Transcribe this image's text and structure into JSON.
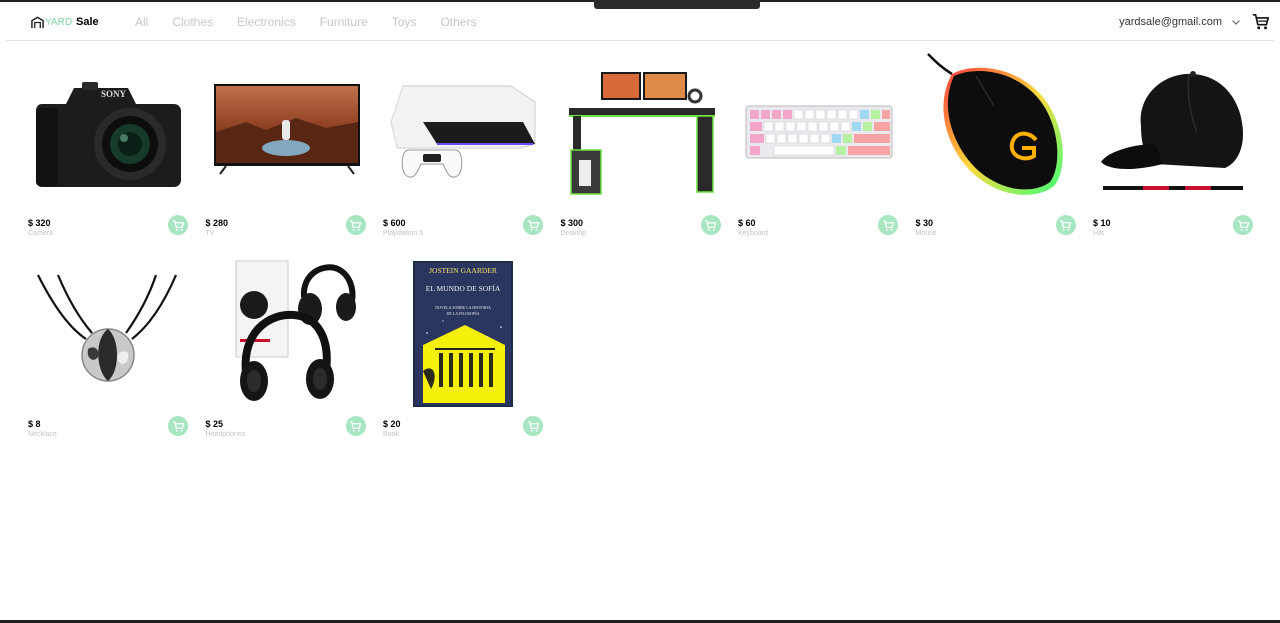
{
  "header": {
    "logo_yard": "YARD",
    "logo_sale": "Sale",
    "nav": [
      "All",
      "Clothes",
      "Electronics",
      "Furniture",
      "Toys",
      "Others"
    ],
    "email": "yardsale@gmail.com",
    "icons": {
      "logo": "yard-logo-icon",
      "dropdown": "chevron-down-icon",
      "cart": "shopping-cart-icon"
    }
  },
  "products": [
    {
      "price": "$ 320",
      "name": "Camera",
      "image": "camera-image"
    },
    {
      "price": "$ 280",
      "name": "TV",
      "image": "tv-image"
    },
    {
      "price": "$ 600",
      "name": "Playstation 5",
      "image": "playstation-image"
    },
    {
      "price": "$ 300",
      "name": "Desktop",
      "image": "desk-image"
    },
    {
      "price": "$ 60",
      "name": "Keyboard",
      "image": "keyboard-image"
    },
    {
      "price": "$ 30",
      "name": "Mouse",
      "image": "mouse-image"
    },
    {
      "price": "$ 10",
      "name": "Hat",
      "image": "cap-image"
    },
    {
      "price": "$ 8",
      "name": "Necklace",
      "image": "necklace-image"
    },
    {
      "price": "$ 25",
      "name": "Headphones",
      "image": "headphones-image"
    },
    {
      "price": "$ 20",
      "name": "Book",
      "image": "book-image"
    }
  ],
  "book_cover": {
    "author": "JOSTEIN GAARDER",
    "title": "EL MUNDO DE SOFÍA",
    "subtitle_line1": "NOVELA SOBRE LA HISTORIA",
    "subtitle_line2": "DE LA FILOSOFÍA"
  },
  "camera_brand": "SONY",
  "colors": {
    "accent": "#a8e6c2",
    "logo_green": "#7fd4a3",
    "nav_inactive": "#c7c7c7",
    "divider": "#e2e2e2"
  }
}
